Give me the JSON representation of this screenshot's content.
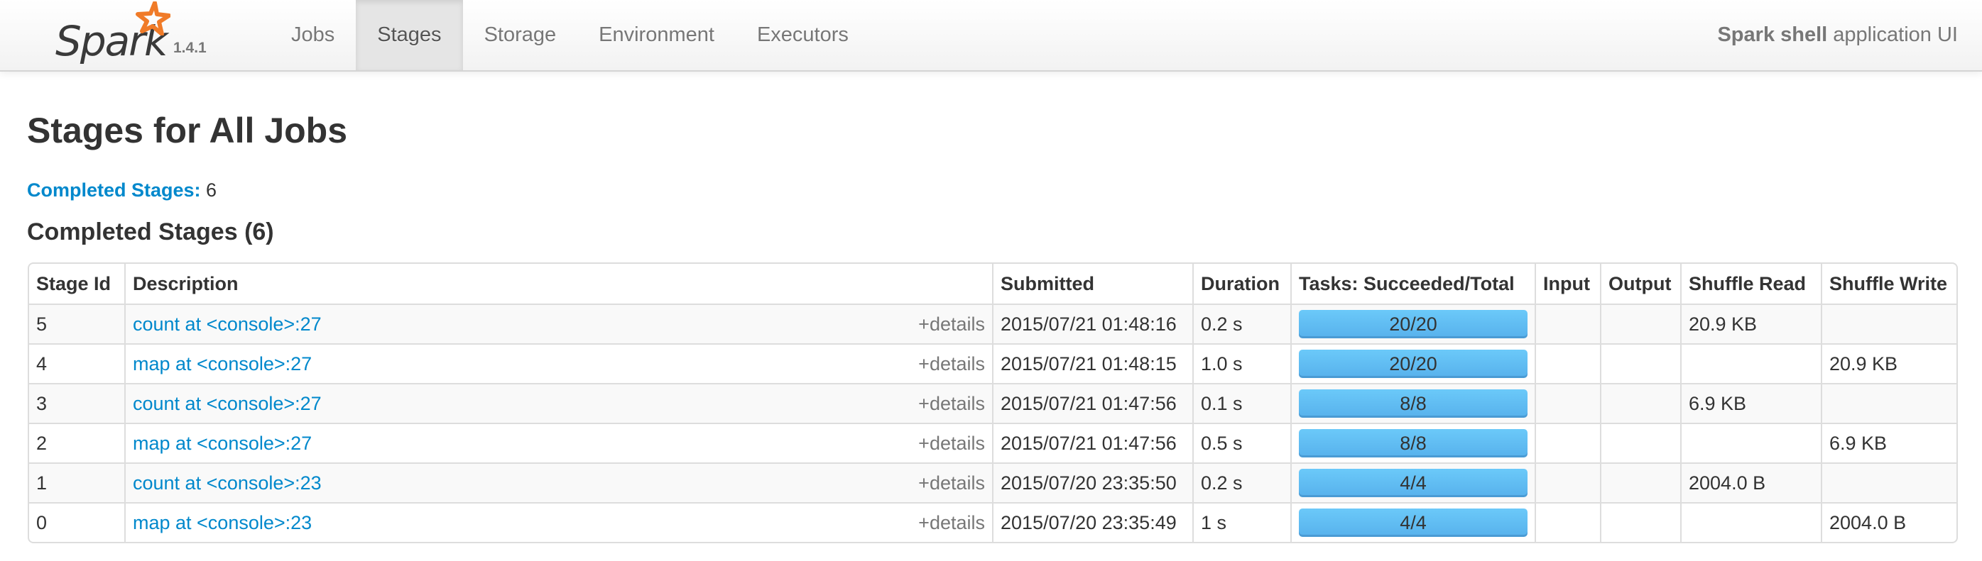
{
  "navbar": {
    "brand": "Spark",
    "version": "1.4.1",
    "tabs": [
      {
        "label": "Jobs",
        "active": false
      },
      {
        "label": "Stages",
        "active": true
      },
      {
        "label": "Storage",
        "active": false
      },
      {
        "label": "Environment",
        "active": false
      },
      {
        "label": "Executors",
        "active": false
      }
    ],
    "app_name_bold": "Spark shell",
    "app_name_suffix": " application UI"
  },
  "page": {
    "title": "Stages for All Jobs",
    "summary_label": "Completed Stages:",
    "summary_count": " 6",
    "section_title": "Completed Stages (6)"
  },
  "table": {
    "headers": [
      "Stage Id",
      "Description",
      "Submitted",
      "Duration",
      "Tasks: Succeeded/Total",
      "Input",
      "Output",
      "Shuffle Read",
      "Shuffle Write"
    ],
    "details_label": "+details",
    "rows": [
      {
        "id": "5",
        "description": "count at <console>:27",
        "submitted": "2015/07/21 01:48:16",
        "duration": "0.2 s",
        "tasks": "20/20",
        "tasks_succeeded": 20,
        "tasks_total": 20,
        "input": "",
        "output": "",
        "shuffle_read": "20.9 KB",
        "shuffle_write": ""
      },
      {
        "id": "4",
        "description": "map at <console>:27",
        "submitted": "2015/07/21 01:48:15",
        "duration": "1.0 s",
        "tasks": "20/20",
        "tasks_succeeded": 20,
        "tasks_total": 20,
        "input": "",
        "output": "",
        "shuffle_read": "",
        "shuffle_write": "20.9 KB"
      },
      {
        "id": "3",
        "description": "count at <console>:27",
        "submitted": "2015/07/21 01:47:56",
        "duration": "0.1 s",
        "tasks": "8/8",
        "tasks_succeeded": 8,
        "tasks_total": 8,
        "input": "",
        "output": "",
        "shuffle_read": "6.9 KB",
        "shuffle_write": ""
      },
      {
        "id": "2",
        "description": "map at <console>:27",
        "submitted": "2015/07/21 01:47:56",
        "duration": "0.5 s",
        "tasks": "8/8",
        "tasks_succeeded": 8,
        "tasks_total": 8,
        "input": "",
        "output": "",
        "shuffle_read": "",
        "shuffle_write": "6.9 KB"
      },
      {
        "id": "1",
        "description": "count at <console>:23",
        "submitted": "2015/07/20 23:35:50",
        "duration": "0.2 s",
        "tasks": "4/4",
        "tasks_succeeded": 4,
        "tasks_total": 4,
        "input": "",
        "output": "",
        "shuffle_read": "2004.0 B",
        "shuffle_write": ""
      },
      {
        "id": "0",
        "description": "map at <console>:23",
        "submitted": "2015/07/20 23:35:49",
        "duration": "1 s",
        "tasks": "4/4",
        "tasks_succeeded": 4,
        "tasks_total": 4,
        "input": "",
        "output": "",
        "shuffle_read": "",
        "shuffle_write": "2004.0 B"
      }
    ]
  },
  "colors": {
    "link": "#0088cc",
    "progress": "#5cbaf2",
    "logo_star": "#f07b28"
  }
}
